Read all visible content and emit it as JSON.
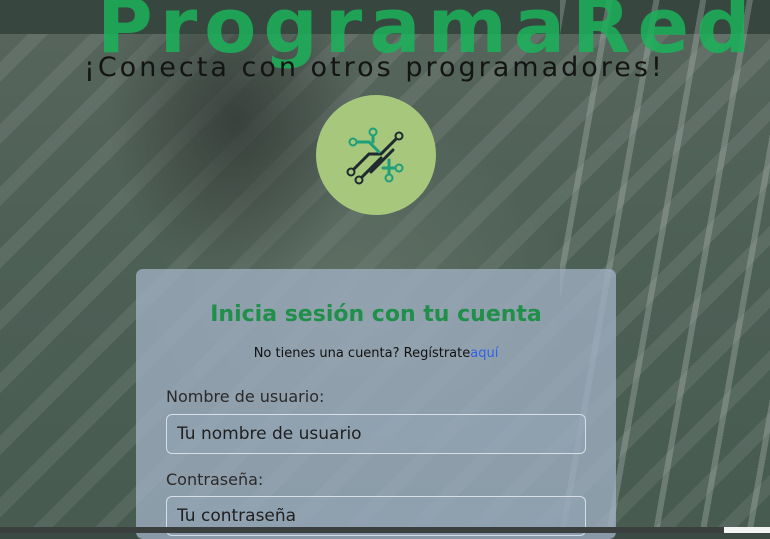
{
  "brand": {
    "title": "ProgramaRed",
    "tagline": "¡Conecta con otros programadores!"
  },
  "logo": {
    "icon": "circuit-icon",
    "bg_color": "#a6c77c"
  },
  "login": {
    "title": "Inicia sesión con tu cuenta",
    "signup_prompt": "No tienes una cuenta? Regístrate",
    "signup_link": "aquí",
    "username_label": "Nombre de usuario:",
    "username_placeholder": "Tu nombre de usuario",
    "password_label": "Contraseña:",
    "password_placeholder": "Tu contraseña"
  },
  "colors": {
    "brand_green": "#1bb35a",
    "title_green": "#1f8f4a",
    "link_blue": "#2f62e6"
  }
}
